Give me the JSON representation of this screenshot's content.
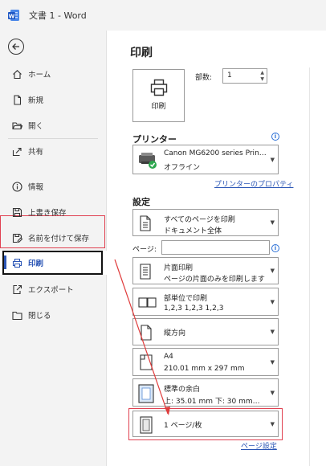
{
  "window": {
    "title": "文書 1  -  Word"
  },
  "sidebar": {
    "items": [
      {
        "label": "ホーム"
      },
      {
        "label": "新規"
      },
      {
        "label": "開く"
      },
      {
        "label": "共有"
      },
      {
        "label": "情報"
      },
      {
        "label": "上書き保存"
      },
      {
        "label": "名前を付けて保存"
      },
      {
        "label": "印刷"
      },
      {
        "label": "エクスポート"
      },
      {
        "label": "閉じる"
      }
    ]
  },
  "print": {
    "heading": "印刷",
    "print_button": "印刷",
    "copies_label": "部数:",
    "copies_value": "1",
    "printer_heading": "プリンター",
    "printer_name": "Canon MG6200 series Prin…",
    "printer_status": "オフライン",
    "printer_properties": "プリンターのプロパティ",
    "settings_heading": "設定",
    "pages_label": "ページ:",
    "page_setup": "ページ設定",
    "settings": [
      {
        "line1": "すべてのページを印刷",
        "line2": "ドキュメント全体"
      },
      {
        "line1": "片面印刷",
        "line2": "ページの片面のみを印刷します"
      },
      {
        "line1": "部単位で印刷",
        "line2": "1,2,3     1,2,3     1,2,3"
      },
      {
        "line1": "縦方向",
        "line2": ""
      },
      {
        "line1": "A4",
        "line2": "210.01 mm x 297 mm"
      },
      {
        "line1": "標準の余白",
        "line2": "上: 35.01 mm 下: 30 mm…"
      },
      {
        "line1": "1 ページ/枚",
        "line2": ""
      }
    ]
  },
  "colors": {
    "accent": "#2a55b5",
    "highlight": "#e04050",
    "printer_ok": "#2ea84f"
  }
}
